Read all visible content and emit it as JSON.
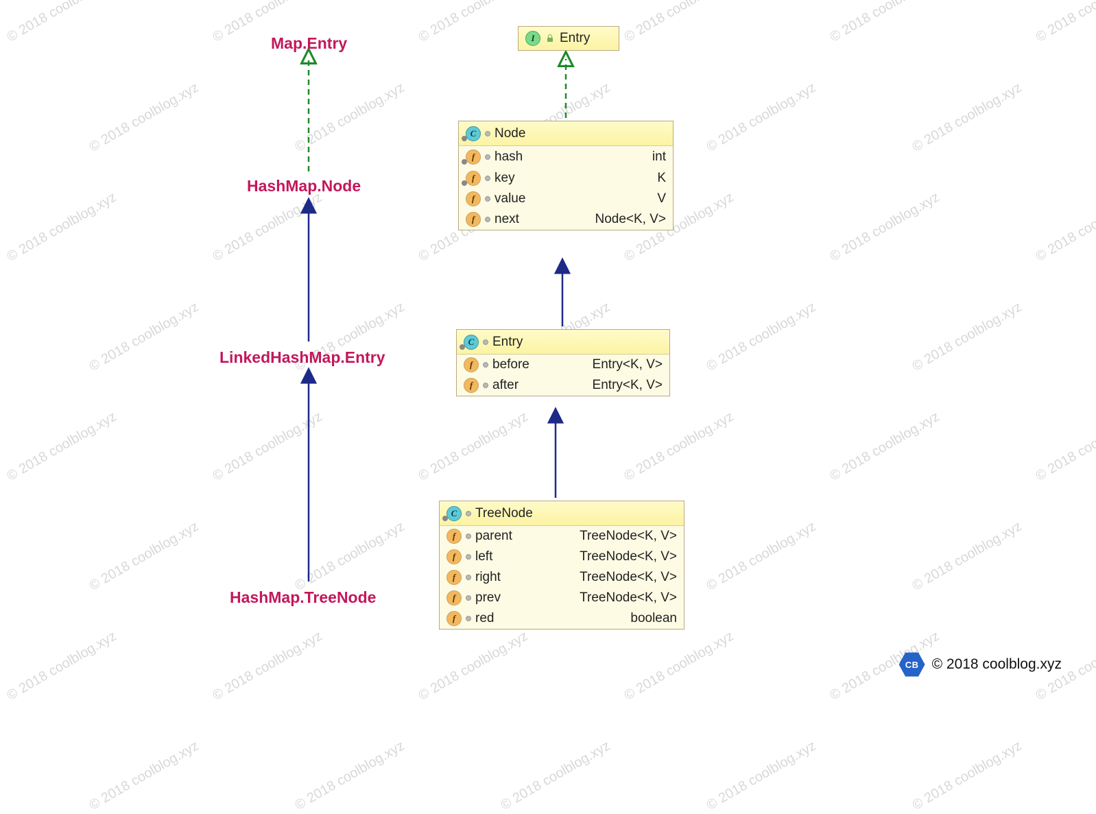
{
  "watermark": "© 2018 coolblog.xyz",
  "leftLabels": {
    "mapEntry": "Map.Entry",
    "hashMapNode": "HashMap.Node",
    "linkedHashMapEntry": "LinkedHashMap.Entry",
    "hashMapTreeNode": "HashMap.TreeNode"
  },
  "interfaceBox": {
    "name": "Entry"
  },
  "nodeBox": {
    "name": "Node",
    "fields": {
      "hash": {
        "name": "hash",
        "type": "int"
      },
      "key": {
        "name": "key",
        "type": "K"
      },
      "value": {
        "name": "value",
        "type": "V"
      },
      "next": {
        "name": "next",
        "type": "Node<K, V>"
      }
    }
  },
  "entryBox": {
    "name": "Entry",
    "fields": {
      "before": {
        "name": "before",
        "type": "Entry<K, V>"
      },
      "after": {
        "name": "after",
        "type": "Entry<K, V>"
      }
    }
  },
  "treeNodeBox": {
    "name": "TreeNode",
    "fields": {
      "parent": {
        "name": "parent",
        "type": "TreeNode<K, V>"
      },
      "left": {
        "name": "left",
        "type": "TreeNode<K, V>"
      },
      "right": {
        "name": "right",
        "type": "TreeNode<K, V>"
      },
      "prev": {
        "name": "prev",
        "type": "TreeNode<K, V>"
      },
      "red": {
        "name": "red",
        "type": "boolean"
      }
    }
  },
  "footer": {
    "logo": "CB",
    "text": "© 2018 coolblog.xyz"
  }
}
